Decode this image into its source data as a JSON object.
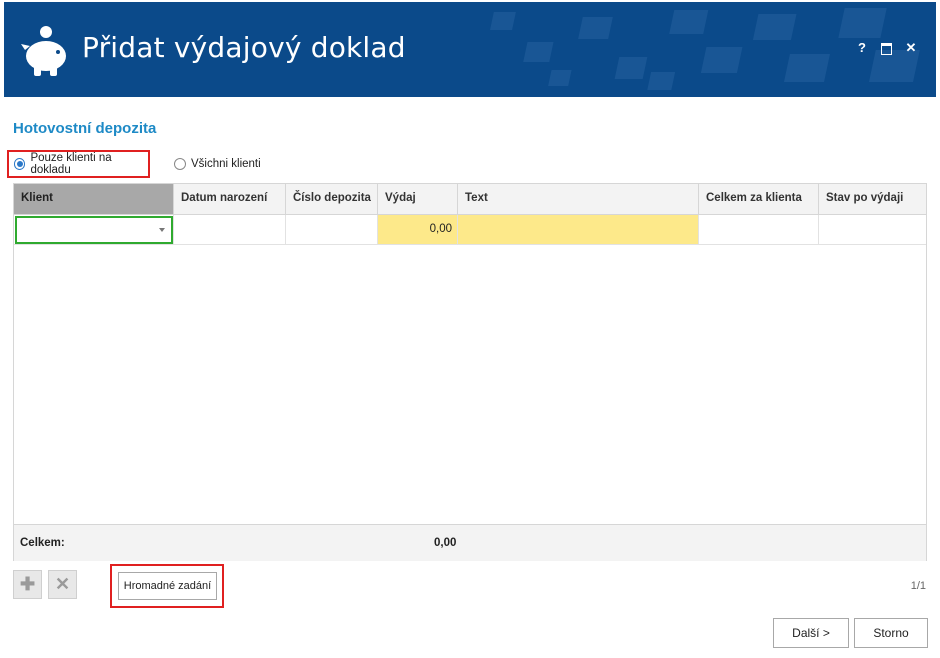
{
  "window": {
    "title": "Přidat výdajový doklad",
    "help_label": "?",
    "close_label": "✕",
    "header_color": "#0b4a8a"
  },
  "section": {
    "title": "Hotovostní depozita"
  },
  "filter": {
    "option_only": "Pouze klienti na dokladu",
    "option_all": "Všichni klienti",
    "selected": "option_only"
  },
  "grid": {
    "columns": [
      "Klient",
      "Datum narození",
      "Číslo depozita",
      "Výdaj",
      "Text",
      "Celkem za klienta",
      "Stav po výdaji"
    ],
    "rows": [
      {
        "klient": "",
        "datum": "",
        "cislo": "",
        "vydaj": "0,00",
        "text": "",
        "celkem": "",
        "stav": ""
      }
    ],
    "footer_label": "Celkem:",
    "footer_total": "0,00"
  },
  "toolbar": {
    "add_icon": "plus-icon",
    "delete_icon": "x-icon",
    "bulk_label": "Hromadné zadání",
    "pager": "1/1"
  },
  "buttons": {
    "next": "Další >",
    "cancel": "Storno"
  },
  "colors": {
    "accent": "#1e8ac6",
    "highlight_red": "#e02020",
    "focus_green": "#2faa2f",
    "editable_yellow": "#fde98a"
  }
}
